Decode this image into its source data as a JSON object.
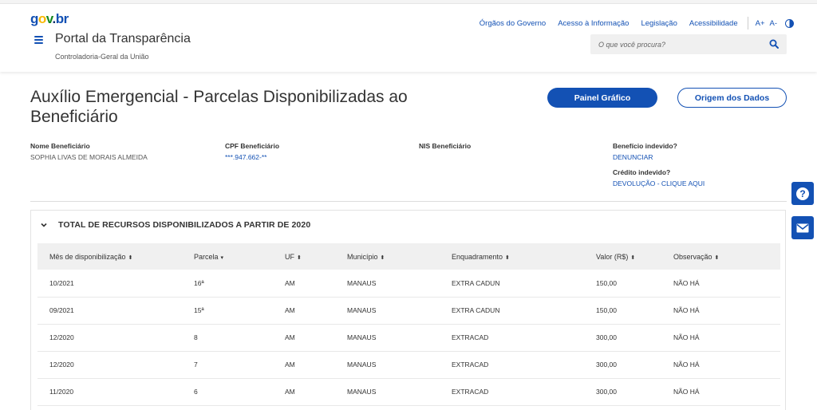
{
  "header": {
    "logo": {
      "g": "g",
      "o1": "o",
      "v": "v",
      "dot": ".",
      "b": "b",
      "r": "r"
    },
    "links": [
      "Órgãos do Governo",
      "Acesso à Informação",
      "Legislação",
      "Acessibilidade"
    ],
    "font_increase": "A+",
    "font_decrease": "A-",
    "portal_title": "Portal da Transparência",
    "portal_subtitle": "Controladoria-Geral da União",
    "search_placeholder": "O que você procura?"
  },
  "page": {
    "title": "Auxílio Emergencial - Parcelas Disponibilizadas ao Beneficiário",
    "buttons": {
      "primary": "Painel Gráfico",
      "secondary": "Origem dos Dados"
    },
    "info": {
      "nome_label": "Nome Beneficiário",
      "nome_value": "SOPHIA LIVAS DE MORAIS ALMEIDA",
      "cpf_label": "CPF Beneficiário",
      "cpf_value": "***.947.662-**",
      "nis_label": "NIS Beneficiário",
      "nis_value": "",
      "beneficio_label": "Benefício indevido?",
      "beneficio_link": "DENUNCIAR",
      "credito_label": "Crédito indevido?",
      "credito_link": "DEVOLUÇÃO - CLIQUE AQUI"
    }
  },
  "side": {
    "help_icon": "question-icon",
    "contact_icon": "envelope-icon"
  },
  "panel": {
    "title": "TOTAL DE RECURSOS DISPONIBILIZADOS A PARTIR DE 2020",
    "columns": [
      "Mês de disponibilização",
      "Parcela",
      "UF",
      "Município",
      "Enquadramento",
      "Valor (R$)",
      "Observação"
    ],
    "sort_glyphs": [
      "⬍",
      "▾",
      "⬍",
      "⬍",
      "⬍",
      "⬍",
      "⬍"
    ],
    "rows": [
      [
        "10/2021",
        "16ª",
        "AM",
        "MANAUS",
        "EXTRA CADUN",
        "150,00",
        "NÃO HÁ"
      ],
      [
        "09/2021",
        "15ª",
        "AM",
        "MANAUS",
        "EXTRA CADUN",
        "150,00",
        "NÃO HÁ"
      ],
      [
        "12/2020",
        "8",
        "AM",
        "MANAUS",
        "EXTRACAD",
        "300,00",
        "NÃO HÁ"
      ],
      [
        "12/2020",
        "7",
        "AM",
        "MANAUS",
        "EXTRACAD",
        "300,00",
        "NÃO HÁ"
      ],
      [
        "11/2020",
        "6",
        "AM",
        "MANAUS",
        "EXTRACAD",
        "300,00",
        "NÃO HÁ"
      ]
    ]
  },
  "colors": {
    "primary": "#1351b4",
    "logo_yellow": "#f8b800",
    "logo_green": "#168821"
  }
}
